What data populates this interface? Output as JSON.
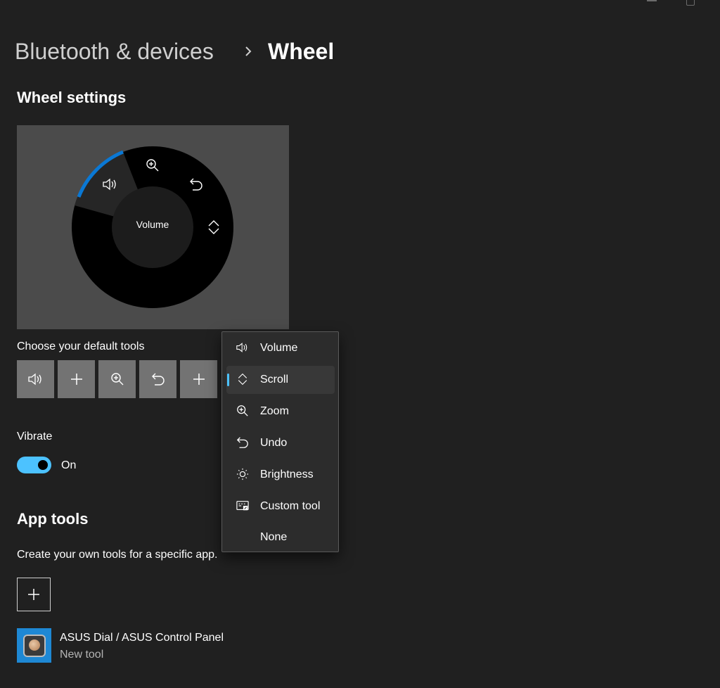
{
  "breadcrumb": {
    "parent": "Bluetooth & devices",
    "separator": "›",
    "current": "Wheel"
  },
  "wheel_settings": {
    "heading": "Wheel settings",
    "preview": {
      "center_label": "Volume"
    }
  },
  "default_tools": {
    "label": "Choose your default tools",
    "buttons": [
      "volume-icon",
      "plus-icon",
      "zoom-in-icon",
      "undo-icon",
      "plus-icon"
    ]
  },
  "vibrate": {
    "label": "Vibrate",
    "state": "On",
    "enabled": true
  },
  "app_tools": {
    "heading": "App tools",
    "description": "Create your own tools for a specific app.",
    "apps": [
      {
        "name": "ASUS Dial / ASUS Control Panel",
        "subtitle": "New tool"
      }
    ]
  },
  "tool_menu": {
    "items": [
      {
        "label": "Volume",
        "icon": "volume-icon"
      },
      {
        "label": "Scroll",
        "icon": "scroll-icon",
        "selected": true
      },
      {
        "label": "Zoom",
        "icon": "zoom-in-icon"
      },
      {
        "label": "Undo",
        "icon": "undo-icon"
      },
      {
        "label": "Brightness",
        "icon": "brightness-icon"
      },
      {
        "label": "Custom tool",
        "icon": "custom-tool-icon"
      },
      {
        "label": "None",
        "icon": ""
      }
    ]
  },
  "colors": {
    "accent": "#4cc2ff",
    "background": "#202020",
    "ring_accent": "#0078d4"
  }
}
